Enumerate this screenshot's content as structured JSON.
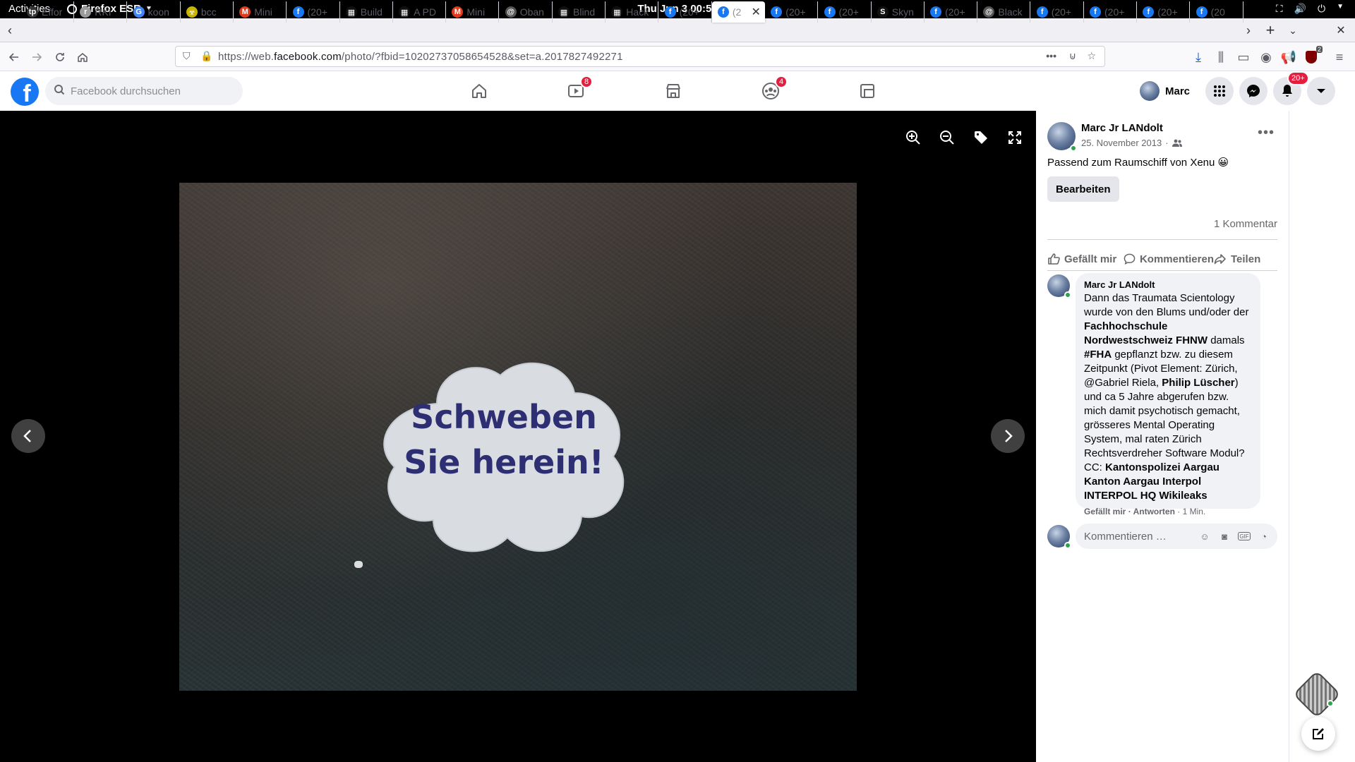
{
  "system_bar": {
    "activities": "Activities",
    "app_name": "Firefox ESR",
    "clock": "Thu Jun 3  00:51"
  },
  "tabs": [
    {
      "label": "Effor",
      "favicon": "tp-icon",
      "color": "#333333"
    },
    {
      "label": "RKI",
      "favicon": "rki-icon",
      "color": "#9a9a9a"
    },
    {
      "label": "koon",
      "favicon": "google-icon",
      "color": "#4285f4"
    },
    {
      "label": "bcc",
      "favicon": "biohazard-icon",
      "color": "#c8b400"
    },
    {
      "label": "Mini",
      "favicon": "minds-icon",
      "color": "#e03a1e"
    },
    {
      "label": "(20+",
      "favicon": "facebook-icon",
      "color": "#1877f2"
    },
    {
      "label": "Build",
      "favicon": "checker-icon",
      "color": "#111111"
    },
    {
      "label": "A PD",
      "favicon": "checker-icon",
      "color": "#111111"
    },
    {
      "label": "Mini",
      "favicon": "minds-icon",
      "color": "#e03a1e"
    },
    {
      "label": "Oban",
      "favicon": "at-icon",
      "color": "#555555"
    },
    {
      "label": "Blind",
      "favicon": "checker-icon",
      "color": "#111111"
    },
    {
      "label": "Hack",
      "favicon": "checker-icon",
      "color": "#111111"
    },
    {
      "label": "(20+",
      "favicon": "facebook-icon",
      "color": "#1877f2"
    },
    {
      "label": "(2",
      "favicon": "facebook-icon",
      "color": "#1877f2",
      "active": true
    },
    {
      "label": "(20+",
      "favicon": "facebook-icon",
      "color": "#1877f2"
    },
    {
      "label": "(20+",
      "favicon": "facebook-icon",
      "color": "#1877f2"
    },
    {
      "label": "Skyn",
      "favicon": "skynet-icon",
      "color": "#111111"
    },
    {
      "label": "(20+",
      "favicon": "facebook-icon",
      "color": "#1877f2"
    },
    {
      "label": "Black",
      "favicon": "at-icon",
      "color": "#555555"
    },
    {
      "label": "(20+",
      "favicon": "facebook-icon",
      "color": "#1877f2"
    },
    {
      "label": "(20+",
      "favicon": "facebook-icon",
      "color": "#1877f2"
    },
    {
      "label": "(20+",
      "favicon": "facebook-icon",
      "color": "#1877f2"
    },
    {
      "label": "(20",
      "favicon": "facebook-icon",
      "color": "#1877f2"
    }
  ],
  "nav": {
    "url_prefix": "https://web.",
    "url_domain": "facebook.com",
    "url_rest": "/photo/?fbid=10202737058654528&set=a.2017827492271",
    "ublock_badge": "2"
  },
  "facebook": {
    "search_placeholder": "Facebook durchsuchen",
    "video_badge": "8",
    "groups_badge": "4",
    "profile_name": "Marc",
    "notifications_badge": "20+"
  },
  "photo": {
    "sign_line1": "Schweben",
    "sign_line2": "Sie herein!"
  },
  "post": {
    "author": "Marc Jr LANdolt",
    "date": "25. November 2013",
    "caption": "Passend zum Raumschiff von Xenu 😀",
    "edit_label": "Bearbeiten",
    "comment_count": "1 Kommentar",
    "like_label": "Gefällt mir",
    "comment_label": "Kommentieren",
    "share_label": "Teilen"
  },
  "comment": {
    "author": "Marc Jr LANdolt",
    "text_1": "Dann das Traumata Scientology wurde von den Blums und/oder der ",
    "bold_1": "Fachhochschule Nordwestschweiz FHNW",
    "text_2": " damals ",
    "bold_2": "#FHA",
    "text_3": " gepflanzt bzw. zu diesem Zeitpunkt (Pivot Element: Zürich, @Gabriel Riela, ",
    "bold_3": "Philip Lüscher",
    "text_4": ") und ca 5 Jahre abgerufen bzw. mich damit psychotisch gemacht, grösseres Mental Operating System, mal raten Zürich Rechtsverdreher Software Modul? CC: ",
    "bold_4": "Kantonspolizei Aargau Kanton Aargau Interpol INTERPOL HQ Wikileaks",
    "like": "Gefällt mir",
    "reply": "Antworten",
    "time": "1 Min.",
    "sep": " · "
  },
  "reply_box": {
    "placeholder": "Kommentieren …"
  }
}
